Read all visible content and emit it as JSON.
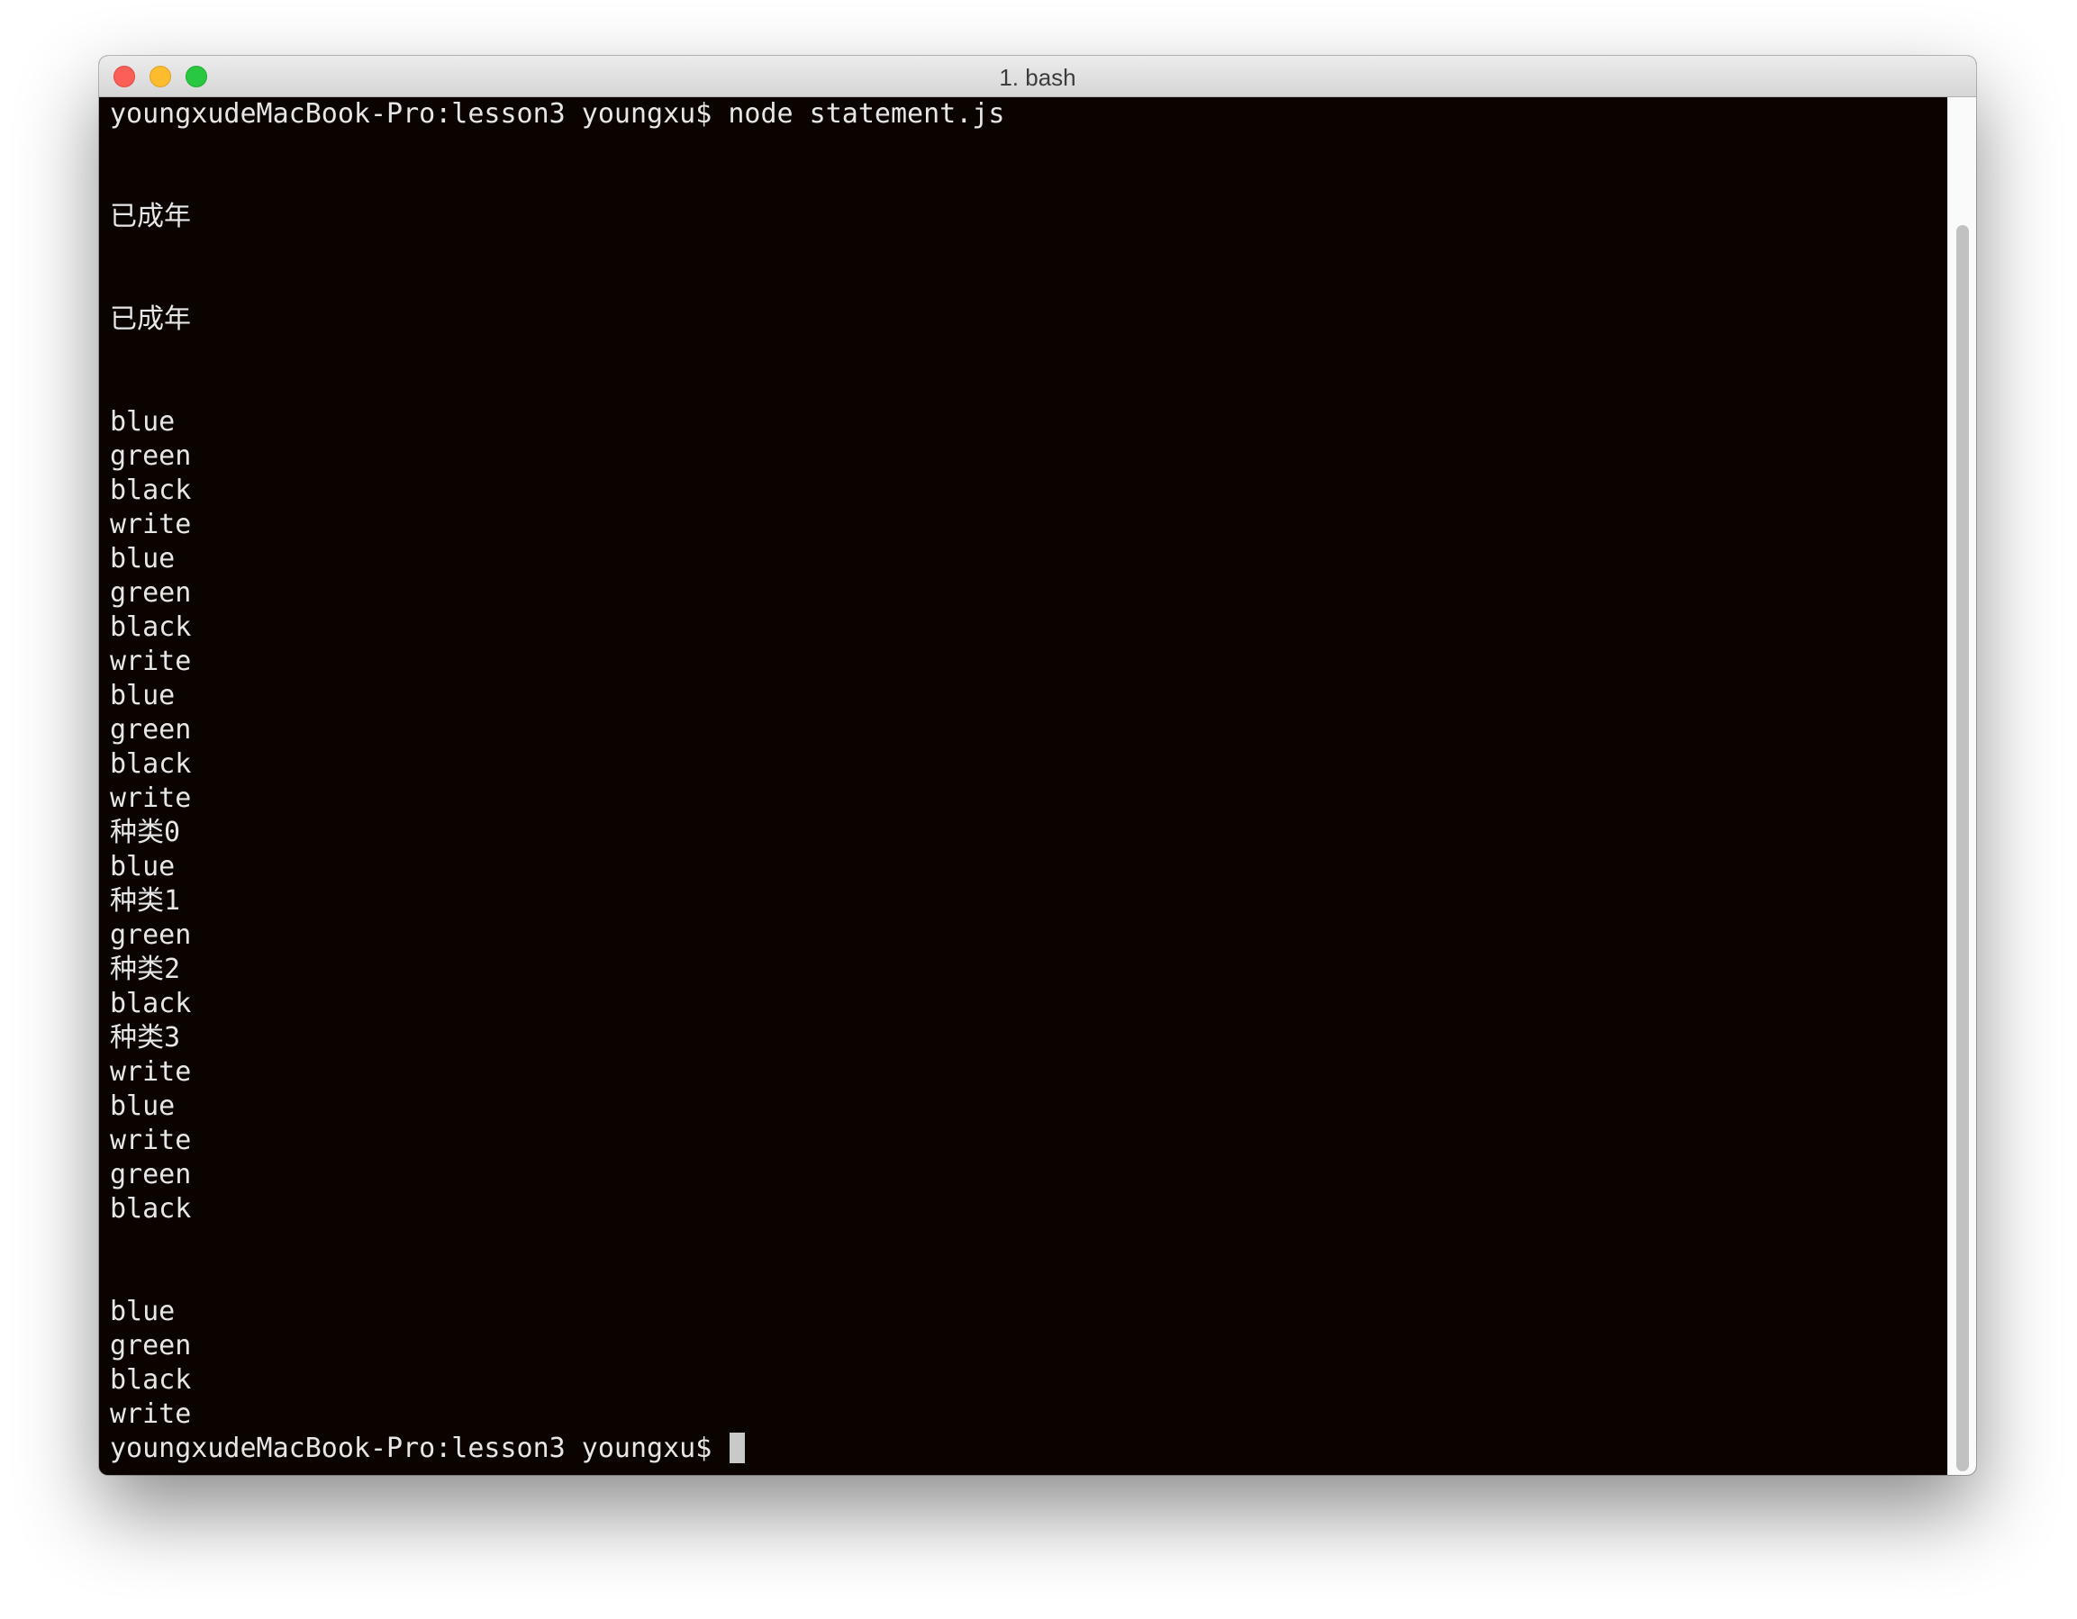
{
  "window": {
    "title": "1. bash"
  },
  "terminal": {
    "command_prompt": "youngxudeMacBook-Pro:lesson3 youngxu$ node statement.js",
    "output_lines": [
      "",
      "",
      "已成年",
      "",
      "",
      "已成年",
      "",
      "",
      "blue",
      "green",
      "black",
      "write",
      "blue",
      "green",
      "black",
      "write",
      "blue",
      "green",
      "black",
      "write",
      "种类0",
      "blue",
      "种类1",
      "green",
      "种类2",
      "black",
      "种类3",
      "write",
      "blue",
      "write",
      "green",
      "black",
      "",
      "",
      "blue",
      "green",
      "black",
      "write"
    ],
    "final_prompt": "youngxudeMacBook-Pro:lesson3 youngxu$ "
  },
  "colors": {
    "terminal_background": "#0a0300",
    "terminal_text": "#e6e6e6",
    "close_button": "#fc5f57",
    "minimize_button": "#fdbc2e",
    "zoom_button": "#28c840"
  }
}
